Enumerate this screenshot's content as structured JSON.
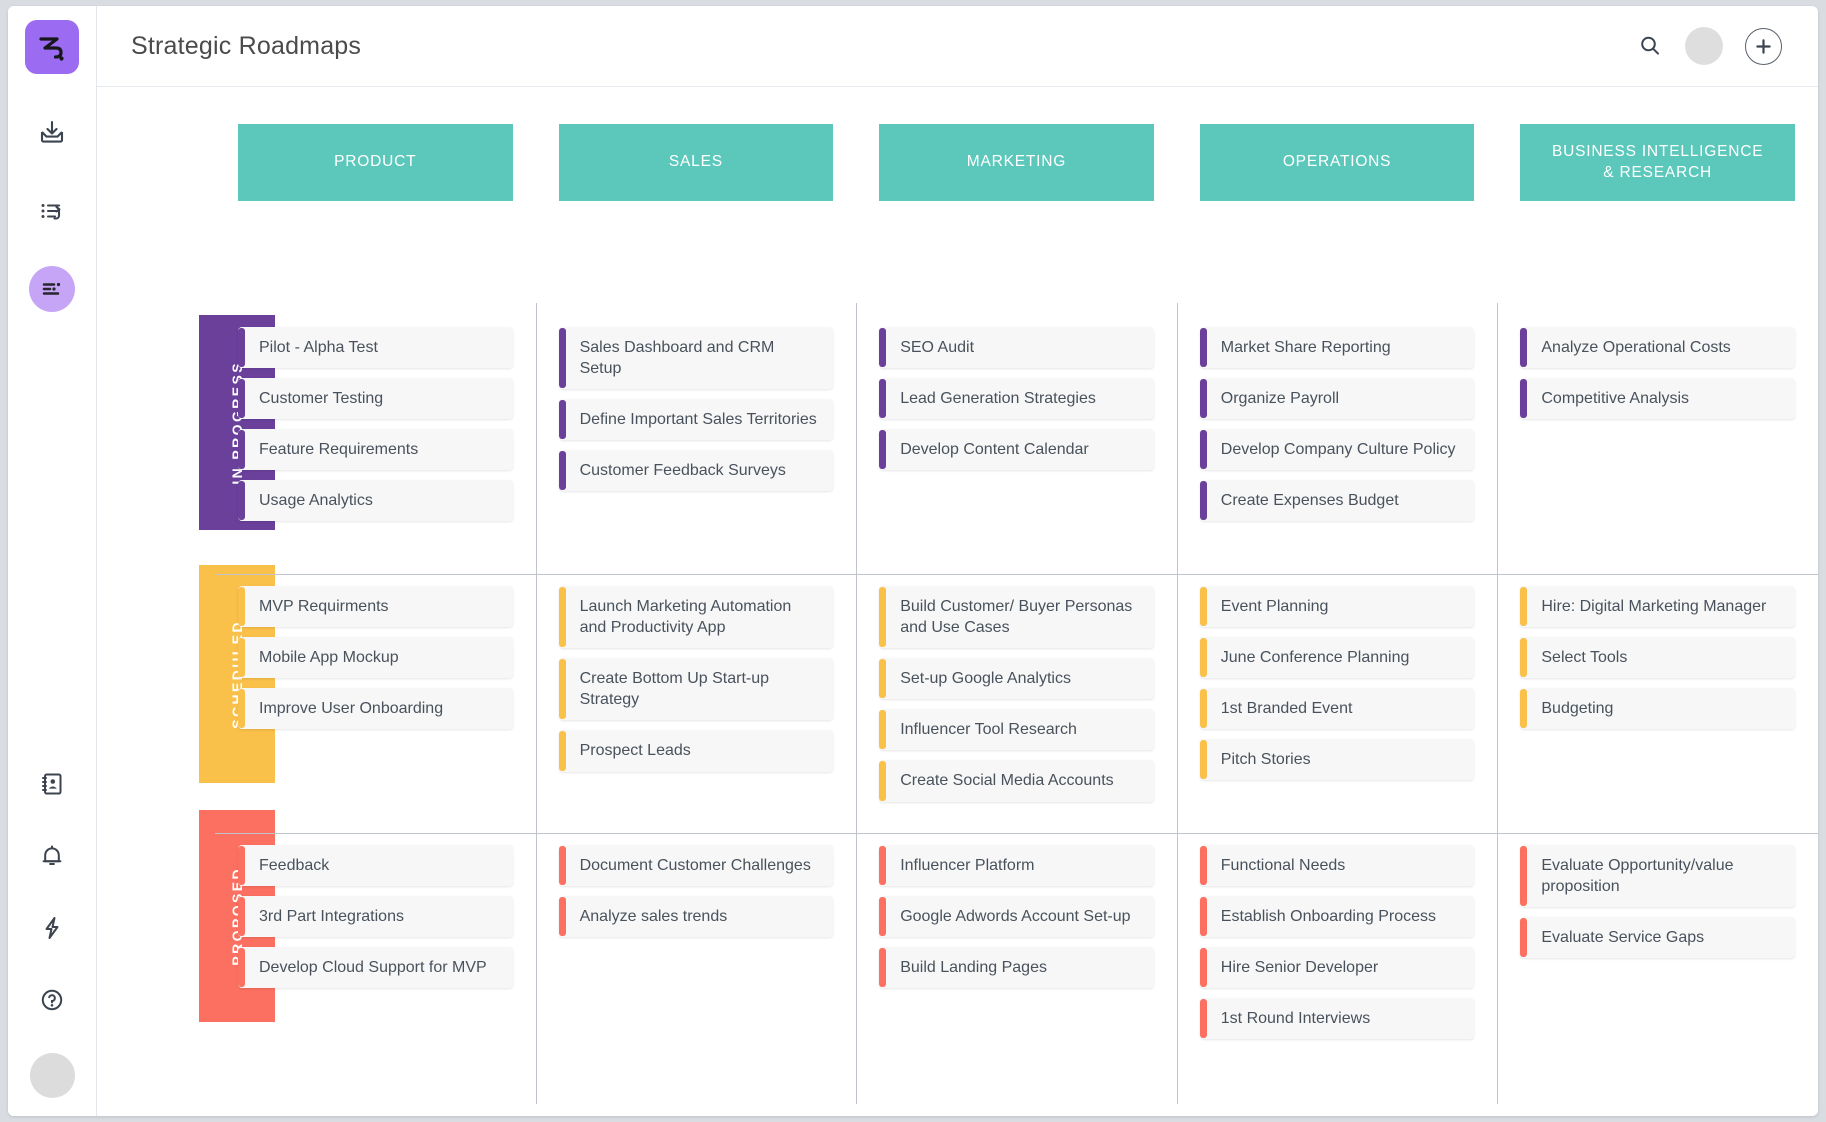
{
  "app": {
    "title": "Strategic Roadmaps"
  },
  "sidebar": {
    "logo_name": "squiggle-logo",
    "items": [
      {
        "name": "inbox-download-icon",
        "label": "Inbox"
      },
      {
        "name": "task-list-undo-icon",
        "label": "Activity"
      },
      {
        "name": "board-lines-icon",
        "label": "Roadmaps"
      }
    ],
    "bottom_items": [
      {
        "name": "contacts-book-icon",
        "label": "Contacts"
      },
      {
        "name": "bell-icon",
        "label": "Notifications"
      },
      {
        "name": "lightning-icon",
        "label": "Automations"
      },
      {
        "name": "help-circle-icon",
        "label": "Help"
      }
    ],
    "avatar_name": "user-avatar"
  },
  "topbar": {
    "search_icon": "search-icon",
    "avatar": "account-avatar",
    "add_icon": "plus-icon"
  },
  "colors": {
    "teal": "#5cc8bb",
    "purple": "#6a409b",
    "yellow": "#f9c04a",
    "red": "#fb7060",
    "logo_purple": "#9b6bf2",
    "card_bg": "#f7f7f7",
    "text": "#49525c"
  },
  "board": {
    "columns": [
      "PRODUCT",
      "SALES",
      "MARKETING",
      "OPERATIONS",
      "BUSINESS INTELLIGENCE\n& RESEARCH"
    ],
    "rows": [
      {
        "label": "IN PROGRESS",
        "color": "#6a409b",
        "cells": [
          [
            "Pilot - Alpha Test",
            "Customer Testing",
            "Feature Requirements",
            "Usage Analytics"
          ],
          [
            "Sales Dashboard and CRM Setup",
            "Define Important Sales Territories",
            "Customer Feedback Surveys"
          ],
          [
            "SEO Audit",
            "Lead Generation Strategies",
            "Develop Content Calendar"
          ],
          [
            "Market Share Reporting",
            "Organize Payroll",
            "Develop Company Culture Policy",
            "Create Expenses Budget"
          ],
          [
            "Analyze Operational Costs",
            "Competitive Analysis"
          ]
        ]
      },
      {
        "label": "SCHEDULED",
        "color": "#f9c04a",
        "cells": [
          [
            "MVP Requirments",
            "Mobile App Mockup",
            "Improve User Onboarding"
          ],
          [
            "Launch Marketing Automation and Productivity App",
            "Create Bottom Up Start-up Strategy",
            "Prospect Leads"
          ],
          [
            "Build Customer/ Buyer Personas and Use Cases",
            "Set-up Google Analytics",
            "Influencer Tool Research",
            "Create Social Media Accounts"
          ],
          [
            "Event Planning",
            "June Conference Planning",
            "1st Branded Event",
            "Pitch Stories"
          ],
          [
            "Hire: Digital Marketing Manager",
            "Select Tools",
            "Budgeting"
          ]
        ]
      },
      {
        "label": "PROPOSED",
        "color": "#fb7060",
        "cells": [
          [
            "Feedback",
            "3rd Part Integrations",
            "Develop Cloud Support for MVP"
          ],
          [
            "Document Customer Challenges",
            "Analyze sales trends"
          ],
          [
            "Influencer Platform",
            "Google Adwords Account Set-up",
            "Build Landing Pages"
          ],
          [
            "Functional Needs",
            "Establish Onboarding Process",
            "Hire Senior Developer",
            "1st Round Interviews"
          ],
          [
            "Evaluate Opportunity/value proposition",
            "Evaluate Service Gaps"
          ]
        ]
      }
    ]
  }
}
